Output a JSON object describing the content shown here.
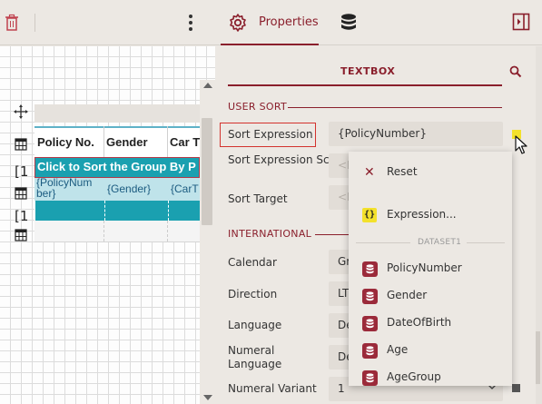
{
  "toolbar": {
    "properties_tab_label": "Properties"
  },
  "designer": {
    "columns": [
      "Policy No.",
      "Gender",
      "Car T"
    ],
    "group_header_text": "Click to Sort the Group By P",
    "detail_cells": [
      "{PolicyNum ber}",
      "{Gender}",
      "{CarT"
    ],
    "row_bracket": "[1"
  },
  "properties": {
    "header_label": "TEXTBOX",
    "sections": {
      "user_sort": "USER SORT",
      "international": "INTERNATIONAL"
    },
    "user_sort": {
      "sort_expression_label": "Sort Expression",
      "sort_expression_value": "{PolicyNumber}",
      "sort_expression_scope_label": "Sort Expression Scope",
      "sort_expression_scope_value": "<E",
      "sort_target_label": "Sort Target",
      "sort_target_value": "<E"
    },
    "international": {
      "calendar_label": "Calendar",
      "calendar_value": "Gr",
      "direction_label": "Direction",
      "direction_value": "LT",
      "language_label": "Language",
      "language_value": "De",
      "numeral_language_label": "Numeral Language",
      "numeral_language_value": "De",
      "numeral_variant_label": "Numeral Variant",
      "numeral_variant_value": "1"
    }
  },
  "dropdown": {
    "reset_label": "Reset",
    "expression_label": "Expression...",
    "dataset_header": "DATASET1",
    "fields": [
      "PolicyNumber",
      "Gender",
      "DateOfBirth",
      "Age",
      "AgeGroup"
    ]
  },
  "colors": {
    "accent": "#8a1f2c",
    "table_header_teal": "#1aa0b0",
    "detail_row": "#bfe3ea",
    "highlight_border": "#d3332e",
    "expression_yellow": "#f3e12b",
    "panel_bg": "#ece8e3"
  },
  "icons": [
    "trash-icon",
    "more-vertical-icon",
    "gear-icon",
    "database-icon",
    "panel-toggle-icon",
    "search-icon",
    "move-icon",
    "table-icon",
    "close-icon",
    "expression-icon",
    "field-icon",
    "chevron-down-icon",
    "mouse-cursor-icon"
  ]
}
